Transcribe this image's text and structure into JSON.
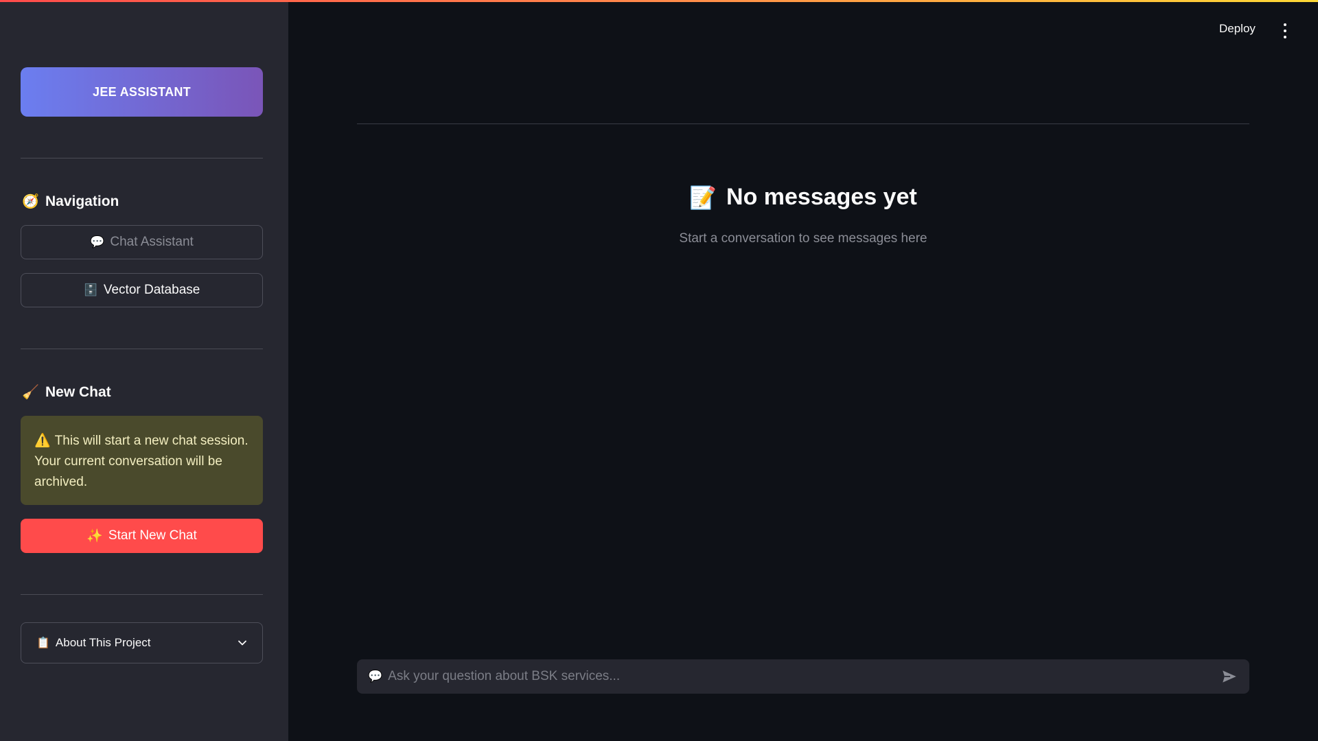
{
  "header": {
    "deploy_label": "Deploy",
    "menu_icon": "kebab-menu-icon"
  },
  "sidebar": {
    "brand": "JEE ASSISTANT",
    "navigation": {
      "title": "Navigation",
      "icon": "🧭",
      "items": [
        {
          "label": "Chat Assistant",
          "icon": "💬",
          "state": "disabled"
        },
        {
          "label": "Vector Database",
          "icon": "🗄️",
          "state": "enabled"
        }
      ]
    },
    "new_chat": {
      "title": "New Chat",
      "icon": "🧹",
      "warning_icon": "⚠️",
      "warning": "This will start a new chat session. Your current conversation will be archived.",
      "button_icon": "✨",
      "button_label": "Start New Chat"
    },
    "about": {
      "icon": "📋",
      "label": "About This Project"
    }
  },
  "main": {
    "empty_icon": "📝",
    "empty_title": "No messages yet",
    "empty_subtitle": "Start a conversation to see messages here",
    "chat_input": {
      "icon": "💬",
      "placeholder": "Ask your question about BSK services...",
      "value": ""
    }
  },
  "colors": {
    "background": "#0e1117",
    "sidebar": "#262730",
    "primary": "#ff4b4b",
    "brand_gradient_start": "#6b7ef0",
    "brand_gradient_end": "#7a55b8",
    "warning_bg": "#4a4a2c"
  }
}
